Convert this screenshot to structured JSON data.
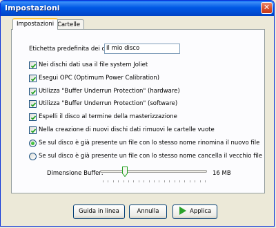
{
  "window": {
    "title": "Impostazioni"
  },
  "tabs": [
    {
      "label": "Impostazioni",
      "active": true
    },
    {
      "label": "Cartelle",
      "active": false
    }
  ],
  "disc_label": {
    "label": "Etichetta predefinita dei dischi",
    "value": "Il mio disco"
  },
  "options": [
    {
      "label": "Nei dischi dati usa il file system Joliet",
      "checked": true
    },
    {
      "label": "Esegui OPC (Optimum Power Calibration)",
      "checked": true
    },
    {
      "label": "Utilizza \"Buffer Underrun Protection\" (hardware)",
      "checked": true
    },
    {
      "label": "Utilizza \"Buffer Underrun Protection\" (software)",
      "checked": true
    },
    {
      "label": "Espelli il disco al termine della masterizzazione",
      "checked": true
    },
    {
      "label": "Nella creazione di nuovi dischi dati rimuovi le cartelle vuote",
      "checked": true
    }
  ],
  "radios": [
    {
      "label": "Se sul disco è già presente un file con lo stesso nome rinomina il nuovo file",
      "selected": true
    },
    {
      "label": "Se sul disco è già presente un file con lo stesso nome cancella il vecchio file",
      "selected": false
    }
  ],
  "buffer": {
    "label": "Dimensione Buffer:",
    "value_text": "16 MB",
    "position_fraction": 0.23
  },
  "buttons": {
    "help": "Guida in linea",
    "cancel": "Annulla",
    "apply": "Applica"
  },
  "colors": {
    "titlebar": "#0058e5",
    "check": "#21a121",
    "apply_icon": "#2aa12a"
  }
}
